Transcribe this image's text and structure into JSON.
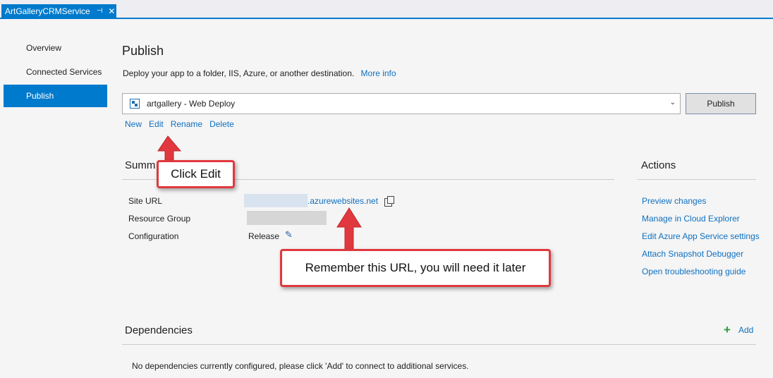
{
  "tab": {
    "title": "ArtGalleryCRMService",
    "pin": "⊣",
    "close": "✕"
  },
  "sidebar": {
    "items": [
      {
        "label": "Overview"
      },
      {
        "label": "Connected Services"
      },
      {
        "label": "Publish",
        "active": true
      }
    ]
  },
  "header": {
    "title": "Publish",
    "subtitle": "Deploy your app to a folder, IIS, Azure, or another destination.",
    "more_info": "More info"
  },
  "profile": {
    "selected": "artgallery - Web Deploy",
    "publish_label": "Publish",
    "links": {
      "new": "New",
      "edit": "Edit",
      "rename": "Rename",
      "delete": "Delete"
    }
  },
  "summary": {
    "heading": "Summ",
    "site_url_label": "Site URL",
    "site_url_value": ".azurewebsites.net",
    "resource_group_label": "Resource Group",
    "configuration_label": "Configuration",
    "configuration_value": "Release"
  },
  "actions": {
    "heading": "Actions",
    "items": [
      "Preview changes",
      "Manage in Cloud Explorer",
      "Edit Azure App Service settings",
      "Attach Snapshot Debugger",
      "Open troubleshooting guide"
    ]
  },
  "dependencies": {
    "heading": "Dependencies",
    "add_label": "Add",
    "empty_message": "No dependencies currently configured, please click 'Add' to connect to additional services."
  },
  "callouts": {
    "click_edit": "Click Edit",
    "remember_url": "Remember this URL, you will need it later"
  },
  "colors": {
    "accent": "#007acc",
    "link": "#0e70c0",
    "callout_border": "#e0383e",
    "add_green": "#2e9b3d"
  }
}
